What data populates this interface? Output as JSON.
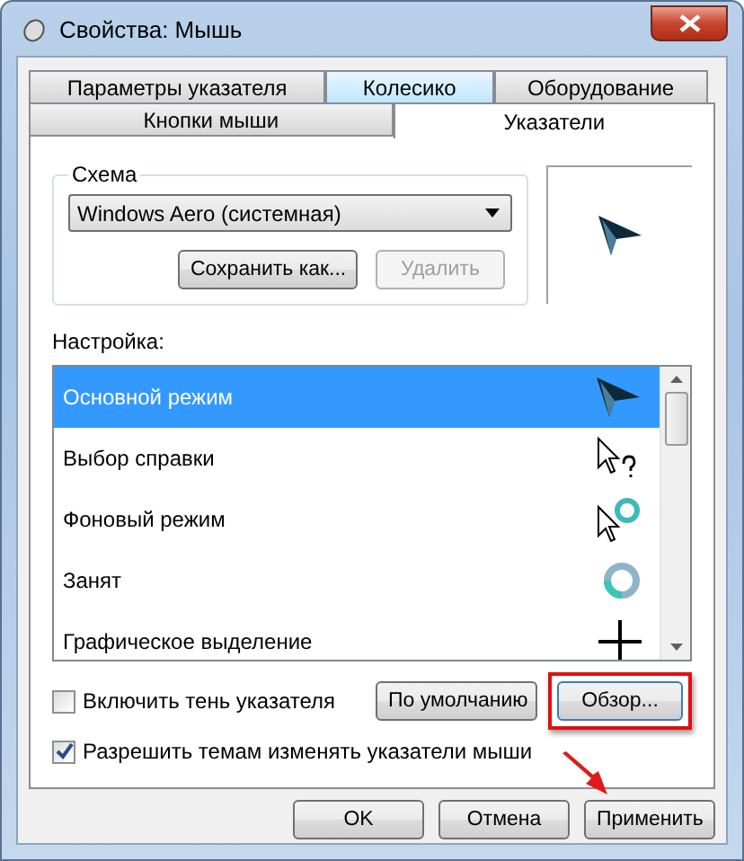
{
  "window": {
    "title": "Свойства: Мышь"
  },
  "tab_rows": [
    [
      {
        "label": "Параметры указателя",
        "selected": false,
        "hovered": false
      },
      {
        "label": "Колесико",
        "selected": false,
        "hovered": true
      },
      {
        "label": "Оборудование",
        "selected": false,
        "hovered": false
      }
    ],
    [
      {
        "label": "Кнопки мыши",
        "selected": false,
        "hovered": false
      },
      {
        "label": "Указатели",
        "selected": true,
        "hovered": false
      }
    ]
  ],
  "scheme": {
    "title": "Схема",
    "value": "Windows Aero (системная)",
    "buttons": [
      {
        "label": "Сохранить как...",
        "disabled": false
      },
      {
        "label": "Удалить",
        "disabled": true
      }
    ]
  },
  "customize": {
    "label": "Настройка:",
    "items": [
      {
        "name": "Основной режим",
        "kind": "arrow",
        "selected": true
      },
      {
        "name": "Выбор справки",
        "kind": "help",
        "selected": false
      },
      {
        "name": "Фоновый режим",
        "kind": "background",
        "selected": false
      },
      {
        "name": "Занят",
        "kind": "busy",
        "selected": false
      },
      {
        "name": "Графическое выделение",
        "kind": "cross",
        "selected": false
      }
    ]
  },
  "shadow_checkbox": {
    "label": "Включить тень указателя",
    "checked": false
  },
  "default_button": {
    "label": "По умолчанию"
  },
  "browse_button": {
    "label": "Обзор...",
    "highlighted": true
  },
  "themes_checkbox": {
    "label": "Разрешить темам изменять указатели мыши",
    "checked": true
  },
  "annotation_arrow": true,
  "buttons": [
    {
      "label": "OK"
    },
    {
      "label": "Отмена"
    },
    {
      "label": "Применить"
    }
  ]
}
